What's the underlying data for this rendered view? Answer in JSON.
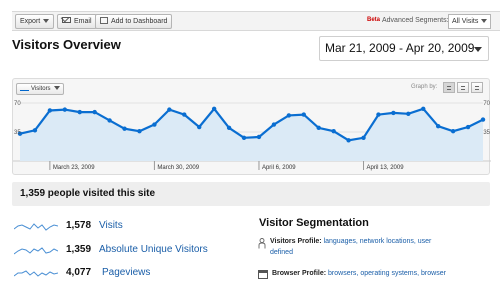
{
  "toolbar": {
    "export_label": "Export",
    "email_label": "Email",
    "dashboard_label": "Add to Dashboard",
    "beta_label": "Beta",
    "segments_label": "Advanced Segments:",
    "segments_value": "All Visits"
  },
  "header": {
    "title": "Visitors Overview",
    "date_range": "Mar 21, 2009 - Apr 20, 2009"
  },
  "chart_controls": {
    "metric_label": "Visitors",
    "graph_by_label": "Graph by:"
  },
  "chart_data": {
    "type": "area",
    "series": [
      {
        "name": "Visitors",
        "values": [
          33,
          37,
          61,
          62,
          59,
          59,
          49,
          39,
          36,
          44,
          62,
          56,
          41,
          63,
          40,
          28,
          29,
          44,
          55,
          56,
          40,
          36,
          25,
          28,
          56,
          58,
          57,
          63,
          42,
          36,
          41,
          50
        ]
      }
    ],
    "x_start": "2009-03-21",
    "x_end": "2009-04-20",
    "x_tick_labels": [
      "March 23, 2009",
      "March 30, 2009",
      "April 6, 2009",
      "April 13, 2009"
    ],
    "y_tick_labels": [
      "70",
      "35"
    ],
    "ylim": [
      0,
      70
    ],
    "grid": true,
    "colors": {
      "line": "#0a6ed1",
      "fill": "#dbeaf6"
    }
  },
  "summary": {
    "text": "1,359 people visited this site"
  },
  "stats": [
    {
      "value": "1,578",
      "label": "Visits"
    },
    {
      "value": "1,359",
      "label": "Absolute Unique Visitors"
    },
    {
      "value": "4,077",
      "label": "Pageviews"
    }
  ],
  "segmentation": {
    "title": "Visitor Segmentation",
    "visitors_profile": {
      "label": "Visitors Profile:",
      "link1": "languages,",
      "link2": "network locations,",
      "link3": "user",
      "link4": "defined"
    },
    "browser_profile": {
      "label": "Browser Profile:",
      "link1": "browsers,",
      "link2": "operating systems,",
      "link3": "browser"
    }
  }
}
